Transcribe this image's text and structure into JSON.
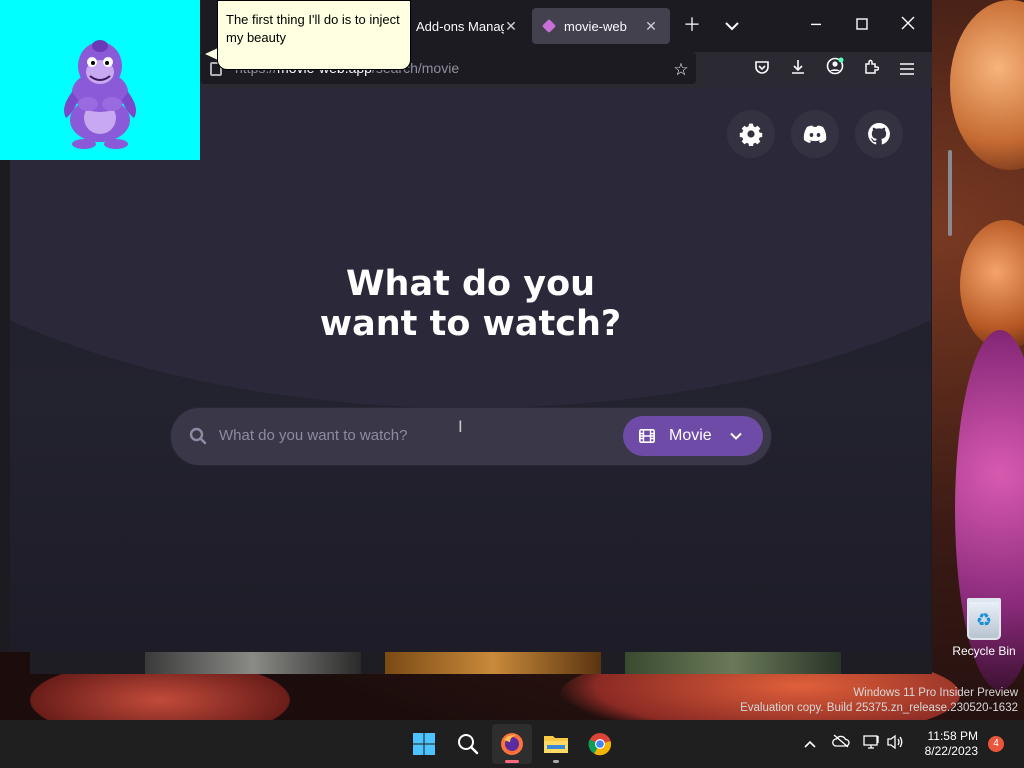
{
  "browser": {
    "tabs": [
      {
        "label": "Add-ons Manager",
        "close": "✕"
      },
      {
        "label": "movie-web",
        "close": "✕",
        "active": true
      }
    ],
    "url": {
      "scheme": "https://",
      "host": "movie-web.app",
      "path": "/search/movie"
    }
  },
  "page": {
    "headline_line1": "What do you",
    "headline_line2": "want to watch?",
    "search": {
      "placeholder": "What do you want to watch?",
      "type_label": "Movie"
    },
    "top_buttons": [
      "settings",
      "discord",
      "github"
    ],
    "colors": {
      "accent": "#6f4ba8",
      "background": "#1f1e29"
    }
  },
  "assistant": {
    "message": "The first thing I'll do is to inject my beauty"
  },
  "desktop": {
    "recycle_bin_label": "Recycle Bin",
    "watermark_line1": "Windows 11 Pro Insider Preview",
    "watermark_line2": "Evaluation copy. Build 25375.zn_release.230520-1632"
  },
  "taskbar": {
    "time": "11:58 PM",
    "date": "8/22/2023",
    "notification_count": "4"
  }
}
